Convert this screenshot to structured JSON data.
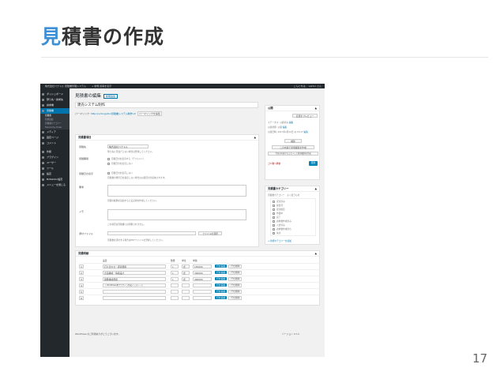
{
  "slide": {
    "title_accent": "見",
    "title_rest": "積書の作成",
    "page_number": "17"
  },
  "admin_bar": {
    "site": "株式会社ベクトル 見積書管理システム",
    "items": "+ 新規  投稿を表示",
    "right": "こんにちは、 vektor さん"
  },
  "sidebar": {
    "items": [
      {
        "label": "ダッシュボード"
      },
      {
        "label": "預り先・請求先"
      },
      {
        "label": "請求書"
      },
      {
        "label": "見積書",
        "active": true
      },
      {
        "label": "メディア"
      },
      {
        "label": "固定ページ"
      },
      {
        "label": "コメント"
      },
      {
        "label": "外観"
      },
      {
        "label": "プラグイン"
      },
      {
        "label": "ユーザー"
      },
      {
        "label": "ツール"
      },
      {
        "label": "設定"
      },
      {
        "label": "BillVektor設定"
      },
      {
        "label": "メニューを閉じる"
      }
    ],
    "subitems": [
      "見積書",
      "新規追加",
      "見積書カテゴリー",
      "Taxonomy Order"
    ]
  },
  "editor": {
    "page_title": "見積書の編集",
    "add_new": "新規追加",
    "post_title": "建売システム制作",
    "permalink_label": "パーマリンク:",
    "permalink_url": "http://vctor.jp/bv/見積書システム制作-2/",
    "permalink_button": "パーマリンクを編集"
  },
  "meta_box": {
    "title": "見積書項目",
    "fields": [
      {
        "label": "見積先",
        "value": "株式会社ベクトル",
        "hint": "預り先に見当たらない場合は登録してください。"
      },
      {
        "label": "見積期間",
        "value": "",
        "hint": ""
      },
      {
        "label": "見積日の表示",
        "value": "",
        "hint": "見積書の発行日を指定しない場合は公開日付が反映されます。"
      },
      {
        "label": "備考",
        "value": "",
        "hint": "見積の履歴を追加すると伝記録を作成してください。"
      },
      {
        "label": "メモ",
        "value": "",
        "hint": "この項目は見積書には印刷されません。"
      },
      {
        "label": "添付ファイル",
        "value": "",
        "hint": "見積書を添付する場合はPDFファイルを登録してください。"
      }
    ],
    "radio_options": [
      "見積日付を表示する（デフォルト）",
      "見積日付を表示しない"
    ],
    "checkbox_label": "見積日付を表示しない",
    "file_button": "ファイルを選択"
  },
  "items_box": {
    "title": "見積明細",
    "headers": [
      "",
      "品目",
      "数量",
      "単位",
      "単価",
      ""
    ],
    "rows": [
      {
        "no": "1",
        "item": "打ち合わせ・調査費用",
        "qty": "1",
        "unit": "式",
        "price": "150000"
      },
      {
        "no": "2",
        "item": "企画構成・情報設計",
        "qty": "1",
        "unit": "式",
        "price": "300000"
      },
      {
        "no": "3",
        "item": "開発構成費用",
        "qty": "1",
        "unit": "式",
        "price": "400000"
      },
      {
        "no": "4",
        "item": "＋ WordPress用プラグイン作成インストール",
        "qty": "",
        "unit": "",
        "price": ""
      },
      {
        "no": "5",
        "item": "",
        "qty": "",
        "unit": "",
        "price": ""
      },
      {
        "no": "6",
        "item": "",
        "qty": "",
        "unit": "",
        "price": ""
      }
    ],
    "add_label": "行を追加",
    "delete_label": "行を削除"
  },
  "publish_box": {
    "title": "公開",
    "preview_button": "変更をプレビュー",
    "status": "ステータス: 公開済み",
    "visibility": "公開状態: 公開",
    "published_on": "公開日時: 2017年2月10日 @ 15:27",
    "edit": "編集",
    "copy_button": "複製",
    "copy_draft": "この内容で新規複製を作成",
    "copy_other": "今回の内容からコピーして新規複製を作成",
    "trash": "ゴミ箱へ移動",
    "update_button": "更新"
  },
  "category_box": {
    "title": "見積書カテゴリー",
    "tabs": "見積書カテゴリー　よく使うもの",
    "items": [
      "受注済み",
      "提出済",
      "受注確定",
      "作業中",
      "完了",
      "請求書作成済み",
      "入金済み",
      "請求書作成待ち",
      "失注"
    ],
    "add_link": "+ 新規カテゴリーを追加"
  },
  "footer": {
    "text": "WordPress のご利用ありがとうございます。",
    "version": "バージョン 4.7.2"
  }
}
